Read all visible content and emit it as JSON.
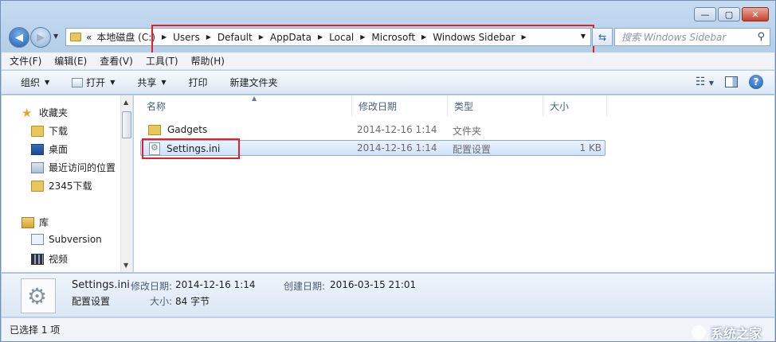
{
  "address": {
    "overflow": "«",
    "crumbs": [
      "本地磁盘 (C:)",
      "Users",
      "Default",
      "AppData",
      "Local",
      "Microsoft",
      "Windows Sidebar"
    ]
  },
  "search": {
    "placeholder": "搜索 Windows Sidebar"
  },
  "menubar": [
    "文件(F)",
    "编辑(E)",
    "查看(V)",
    "工具(T)",
    "帮助(H)"
  ],
  "toolbar": {
    "organize": "组织",
    "open": "打开",
    "share": "共享",
    "print": "打印",
    "new_folder": "新建文件夹"
  },
  "navpane": {
    "favorites": "收藏夹",
    "downloads": "下载",
    "desktop": "桌面",
    "recent": "最近访问的位置",
    "downloads2345": "2345下载",
    "libraries": "库",
    "subversion": "Subversion",
    "videos": "视频"
  },
  "columns": {
    "name": "名称",
    "modified": "修改日期",
    "type": "类型",
    "size": "大小"
  },
  "files": [
    {
      "name": "Gadgets",
      "modified": "2014-12-16 1:14",
      "type": "文件夹",
      "size": ""
    },
    {
      "name": "Settings.ini",
      "modified": "2014-12-16 1:14",
      "type": "配置设置",
      "size": "1 KB"
    }
  ],
  "details": {
    "filename": "Settings.ini",
    "type": "配置设置",
    "modified_label": "修改日期:",
    "modified_value": "2014-12-16 1:14",
    "created_label": "创建日期:",
    "created_value": "2016-03-15 21:01",
    "size_label": "大小:",
    "size_value": "84 字节"
  },
  "status": {
    "text": "已选择 1 项"
  },
  "watermark": {
    "text": "系统之家"
  },
  "colors": {
    "highlight_red": "#e0222b",
    "selection_blue": "#cfe3fa"
  }
}
